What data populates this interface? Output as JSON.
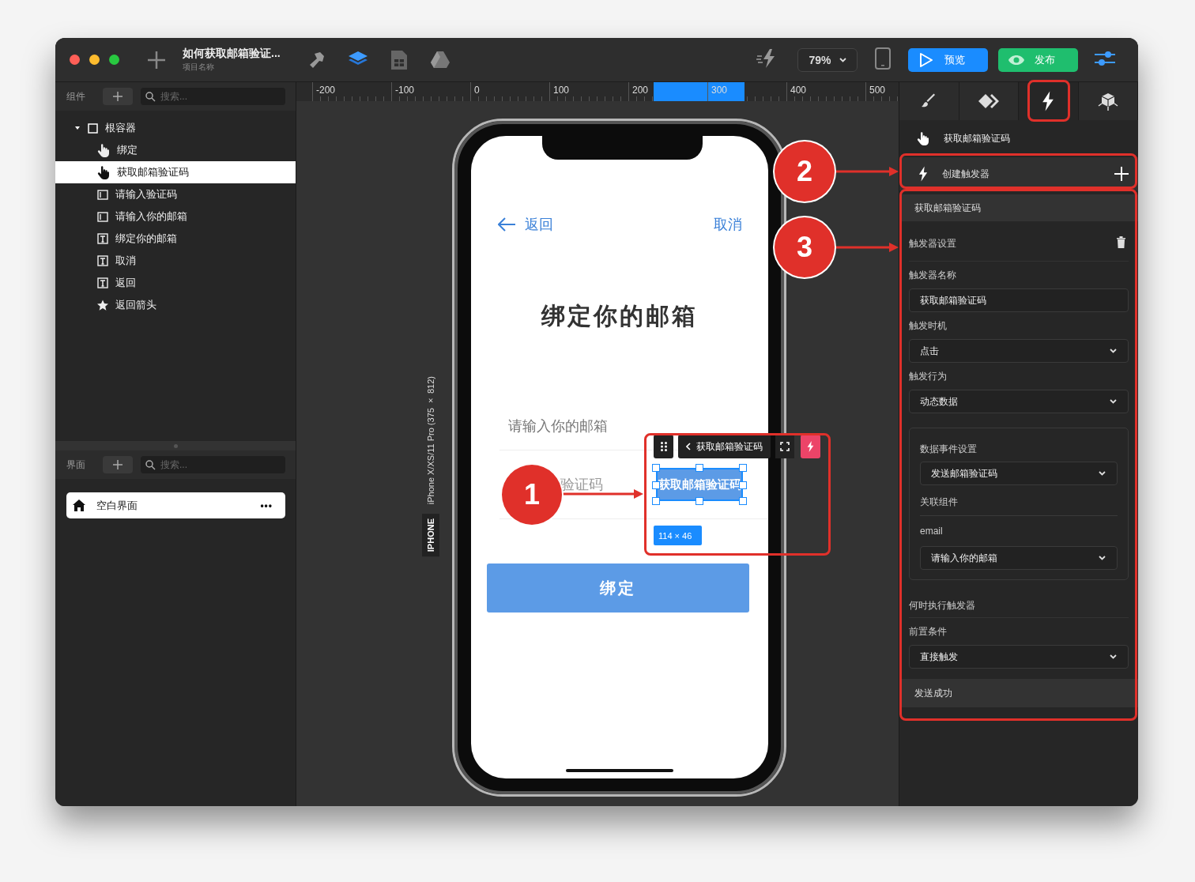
{
  "window": {
    "title": "如何获取邮箱验证...",
    "subtitle": "项目名称",
    "zoom": "79%",
    "preview_button": "预览",
    "publish_button": "发布"
  },
  "components_panel": {
    "label": "组件",
    "search_placeholder": "搜索...",
    "tree": [
      {
        "label": "根容器",
        "kind": "container",
        "expanded": true,
        "selected": false,
        "children": [
          {
            "label": "绑定",
            "kind": "hand",
            "selected": false
          },
          {
            "label": "获取邮箱验证码",
            "kind": "hand",
            "selected": true
          },
          {
            "label": "请输入验证码",
            "kind": "input",
            "selected": false
          },
          {
            "label": "请输入你的邮箱",
            "kind": "input",
            "selected": false
          },
          {
            "label": "绑定你的邮箱",
            "kind": "text",
            "selected": false
          },
          {
            "label": "取消",
            "kind": "text",
            "selected": false
          },
          {
            "label": "返回",
            "kind": "text",
            "selected": false
          },
          {
            "label": "返回箭头",
            "kind": "star",
            "selected": false
          }
        ]
      }
    ]
  },
  "screens_panel": {
    "label": "界面",
    "search_placeholder": "搜索...",
    "screens": [
      {
        "label": "空白界面",
        "more": "•••"
      }
    ]
  },
  "ruler": {
    "ticks": [
      "-200",
      "-100",
      "0",
      "100",
      "200",
      "300",
      "400",
      "500"
    ]
  },
  "device": {
    "model": "iPhone X/XS/11 Pro (375 × 812)",
    "type": "IPHONE"
  },
  "phone_screen": {
    "back": "返回",
    "cancel": "取消",
    "title": "绑定你的邮箱",
    "email_placeholder": "请输入你的邮箱",
    "code_placeholder": "验证码",
    "code_button": "获取邮箱验证码",
    "bind_button": "绑定"
  },
  "selection": {
    "label": "获取邮箱验证码",
    "size": "114 × 46"
  },
  "inspector": {
    "tabs": [
      {
        "kind": "style",
        "selected": false
      },
      {
        "kind": "interaction",
        "selected": false
      },
      {
        "kind": "trigger",
        "selected": true
      },
      {
        "kind": "component",
        "selected": false
      }
    ],
    "component": "获取邮箱验证码",
    "create_trigger": "创建触发器",
    "trigger": {
      "name": "获取邮箱验证码",
      "settings_title": "触发器设置",
      "name_label": "触发器名称",
      "name_value": "获取邮箱验证码",
      "timing_label": "触发时机",
      "timing_value": "点击",
      "action_label": "触发行为",
      "action_value": "动态数据",
      "data_event": {
        "title": "数据事件设置",
        "event_value": "发送邮箱验证码",
        "link_label": "关联组件",
        "field_label": "email",
        "field_value": "请输入你的邮箱"
      },
      "when_title": "何时执行触发器",
      "condition_label": "前置条件",
      "condition_value": "直接触发",
      "next_trigger": "发送成功"
    }
  },
  "annotations": [
    {
      "label": "1"
    },
    {
      "label": "2"
    },
    {
      "label": "3"
    }
  ]
}
